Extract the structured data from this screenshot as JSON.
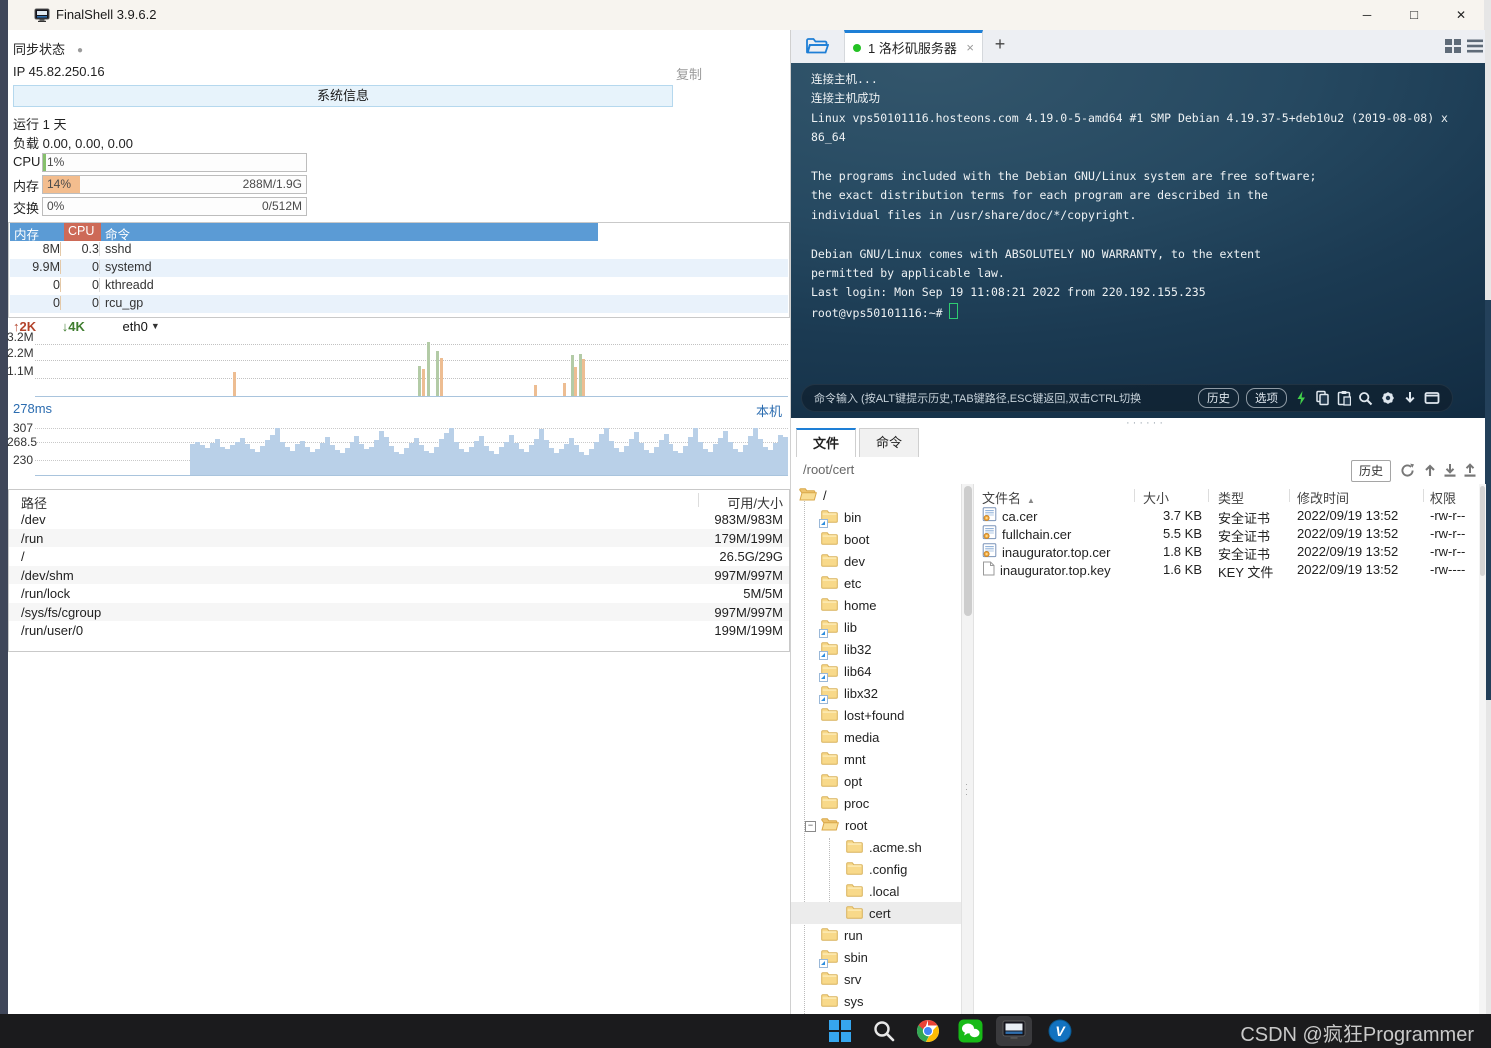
{
  "window": {
    "title": "FinalShell 3.9.6.2"
  },
  "icons": {
    "minimize": "─",
    "maximize": "□",
    "close": "✕",
    "tab_close": "×",
    "plus": "+",
    "sort_asc": "▲",
    "dropdown_arrow": "▼",
    "up_arrow": "↑",
    "down_arrow": "↓",
    "sync_dot": "●",
    "drag_dots": "······"
  },
  "colors": {
    "accent": "#1e7fd6",
    "tab_dot": "#24c224",
    "net_up": "#edbd92",
    "net_down": "#b3cba6",
    "ping_fill": "#b9d0e8"
  },
  "monitor": {
    "sync_label": "同步状态",
    "ip": "IP 45.82.250.16",
    "copy_label": "复制",
    "sysinfo_button": "系统信息",
    "uptime": "运行 1 天",
    "load": "负载 0.00, 0.00, 0.00",
    "gauges": [
      {
        "label": "CPU",
        "value": "1%",
        "detail": "",
        "fill": 1.2,
        "color": "#86c06c"
      },
      {
        "label": "内存",
        "value": "14%",
        "detail": "288M/1.9G",
        "fill": 14,
        "color": "#f3bd8e"
      },
      {
        "label": "交换",
        "value": "0%",
        "detail": "0/512M",
        "fill": 0,
        "color": "#f3bd8e"
      }
    ],
    "process_table": {
      "headers": [
        "内存",
        "CPU",
        "命令"
      ],
      "rows": [
        [
          "8M",
          "0.3",
          "sshd"
        ],
        [
          "9.9M",
          "0",
          "systemd"
        ],
        [
          "0",
          "0",
          "kthreadd"
        ],
        [
          "0",
          "0",
          "rcu_gp"
        ]
      ]
    },
    "network": {
      "up": "2K",
      "down": "4K",
      "iface": "eth0",
      "yticks": [
        "3.2M",
        "2.2M",
        "1.1M"
      ],
      "bars": [
        {
          "x": 198,
          "h": 1.45,
          "c": "o"
        },
        {
          "x": 383,
          "h": 1.85,
          "c": "g"
        },
        {
          "x": 387,
          "h": 1.65,
          "c": "o"
        },
        {
          "x": 392,
          "h": 3.3,
          "c": "g"
        },
        {
          "x": 401,
          "h": 2.75,
          "c": "g"
        },
        {
          "x": 405,
          "h": 2.35,
          "c": "o"
        },
        {
          "x": 499,
          "h": 0.7,
          "c": "o"
        },
        {
          "x": 528,
          "h": 0.8,
          "c": "o"
        },
        {
          "x": 536,
          "h": 2.5,
          "c": "g"
        },
        {
          "x": 539,
          "h": 1.8,
          "c": "o"
        },
        {
          "x": 544,
          "h": 2.6,
          "c": "g"
        },
        {
          "x": 547,
          "h": 2.3,
          "c": "o"
        }
      ]
    },
    "ping": {
      "latency": "278ms",
      "target": "本机",
      "yticks": [
        "307",
        "268.5",
        "230"
      ],
      "values": [
        268,
        272,
        265,
        258,
        270,
        281,
        262,
        255,
        266,
        274,
        283,
        269,
        257,
        249,
        263,
        278,
        290,
        307,
        272,
        260,
        252,
        268,
        275,
        262,
        248,
        257,
        271,
        284,
        266,
        253,
        247,
        259,
        272,
        288,
        268,
        255,
        262,
        277,
        300,
        285,
        263,
        250,
        244,
        258,
        270,
        282,
        265,
        252,
        246,
        261,
        279,
        295,
        307,
        274,
        256,
        248,
        262,
        275,
        286,
        264,
        251,
        245,
        260,
        273,
        289,
        270,
        257,
        250,
        266,
        281,
        303,
        278,
        259,
        247,
        255,
        269,
        283,
        265,
        250,
        243,
        257,
        274,
        291,
        307,
        276,
        258,
        249,
        264,
        280,
        297,
        271,
        254,
        246,
        262,
        278,
        293,
        268,
        252,
        247,
        263,
        285,
        305,
        274,
        256,
        250,
        267,
        282,
        299,
        273,
        255,
        248,
        265,
        287,
        307,
        279,
        261,
        253,
        270,
        290,
        284
      ]
    },
    "disk_table": {
      "headers": [
        "路径",
        "可用/大小"
      ],
      "rows": [
        [
          "/dev",
          "983M/983M"
        ],
        [
          "/run",
          "179M/199M"
        ],
        [
          "/",
          "26.5G/29G"
        ],
        [
          "/dev/shm",
          "997M/997M"
        ],
        [
          "/run/lock",
          "5M/5M"
        ],
        [
          "/sys/fs/cgroup",
          "997M/997M"
        ],
        [
          "/run/user/0",
          "199M/199M"
        ]
      ]
    }
  },
  "session": {
    "tab_label": "1 洛杉矶服务器",
    "terminal": {
      "lines": [
        "连接主机...",
        "连接主机成功",
        "Linux vps50101116.hosteons.com 4.19.0-5-amd64 #1 SMP Debian 4.19.37-5+deb10u2 (2019-08-08) x",
        "86_64",
        "",
        "The programs included with the Debian GNU/Linux system are free software;",
        "the exact distribution terms for each program are described in the",
        "individual files in /usr/share/doc/*/copyright.",
        "",
        "Debian GNU/Linux comes with ABSOLUTELY NO WARRANTY, to the extent",
        "permitted by applicable law.",
        "Last login: Mon Sep 19 11:08:21 2022 from 220.192.155.235"
      ],
      "prompt": "root@vps50101116:~# "
    },
    "toolbar": {
      "hint": "命令输入 (按ALT键提示历史,TAB键路径,ESC键返回,双击CTRL切换",
      "history": "历史",
      "options": "选项"
    }
  },
  "files": {
    "tab_files": "文件",
    "tab_cmd": "命令",
    "path": "/root/cert",
    "history": "历史",
    "tree": [
      {
        "label": "/",
        "depth": 0,
        "type": "open"
      },
      {
        "label": "bin",
        "depth": 1,
        "type": "link"
      },
      {
        "label": "boot",
        "depth": 1,
        "type": "folder"
      },
      {
        "label": "dev",
        "depth": 1,
        "type": "folder"
      },
      {
        "label": "etc",
        "depth": 1,
        "type": "folder"
      },
      {
        "label": "home",
        "depth": 1,
        "type": "folder"
      },
      {
        "label": "lib",
        "depth": 1,
        "type": "link"
      },
      {
        "label": "lib32",
        "depth": 1,
        "type": "link"
      },
      {
        "label": "lib64",
        "depth": 1,
        "type": "link"
      },
      {
        "label": "libx32",
        "depth": 1,
        "type": "link"
      },
      {
        "label": "lost+found",
        "depth": 1,
        "type": "folder"
      },
      {
        "label": "media",
        "depth": 1,
        "type": "folder"
      },
      {
        "label": "mnt",
        "depth": 1,
        "type": "folder"
      },
      {
        "label": "opt",
        "depth": 1,
        "type": "folder"
      },
      {
        "label": "proc",
        "depth": 1,
        "type": "folder"
      },
      {
        "label": "root",
        "depth": 1,
        "type": "open",
        "expander": true
      },
      {
        "label": ".acme.sh",
        "depth": 2,
        "type": "folder"
      },
      {
        "label": ".config",
        "depth": 2,
        "type": "folder"
      },
      {
        "label": ".local",
        "depth": 2,
        "type": "folder"
      },
      {
        "label": "cert",
        "depth": 2,
        "type": "folder",
        "selected": true
      },
      {
        "label": "run",
        "depth": 1,
        "type": "folder"
      },
      {
        "label": "sbin",
        "depth": 1,
        "type": "link"
      },
      {
        "label": "srv",
        "depth": 1,
        "type": "folder"
      },
      {
        "label": "sys",
        "depth": 1,
        "type": "folder"
      }
    ],
    "list": {
      "headers": [
        "文件名",
        "大小",
        "类型",
        "修改时间",
        "权限"
      ],
      "rows": [
        {
          "name": "ca.cer",
          "size": "3.7 KB",
          "type": "安全证书",
          "mtime": "2022/09/19 13:52",
          "perm": "-rw-r--",
          "icon": "cert"
        },
        {
          "name": "fullchain.cer",
          "size": "5.5 KB",
          "type": "安全证书",
          "mtime": "2022/09/19 13:52",
          "perm": "-rw-r--",
          "icon": "cert"
        },
        {
          "name": "inaugurator.top.cer",
          "size": "1.8 KB",
          "type": "安全证书",
          "mtime": "2022/09/19 13:52",
          "perm": "-rw-r--",
          "icon": "cert"
        },
        {
          "name": "inaugurator.top.key",
          "size": "1.6 KB",
          "type": "KEY 文件",
          "mtime": "2022/09/19 13:52",
          "perm": "-rw----",
          "icon": "file"
        }
      ]
    }
  },
  "taskbar": {
    "apps": [
      "start",
      "search",
      "chrome",
      "wechat",
      "finalshell",
      "v2rayn"
    ],
    "active_app": "finalshell",
    "watermark": "CSDN @疯狂Programmer"
  }
}
